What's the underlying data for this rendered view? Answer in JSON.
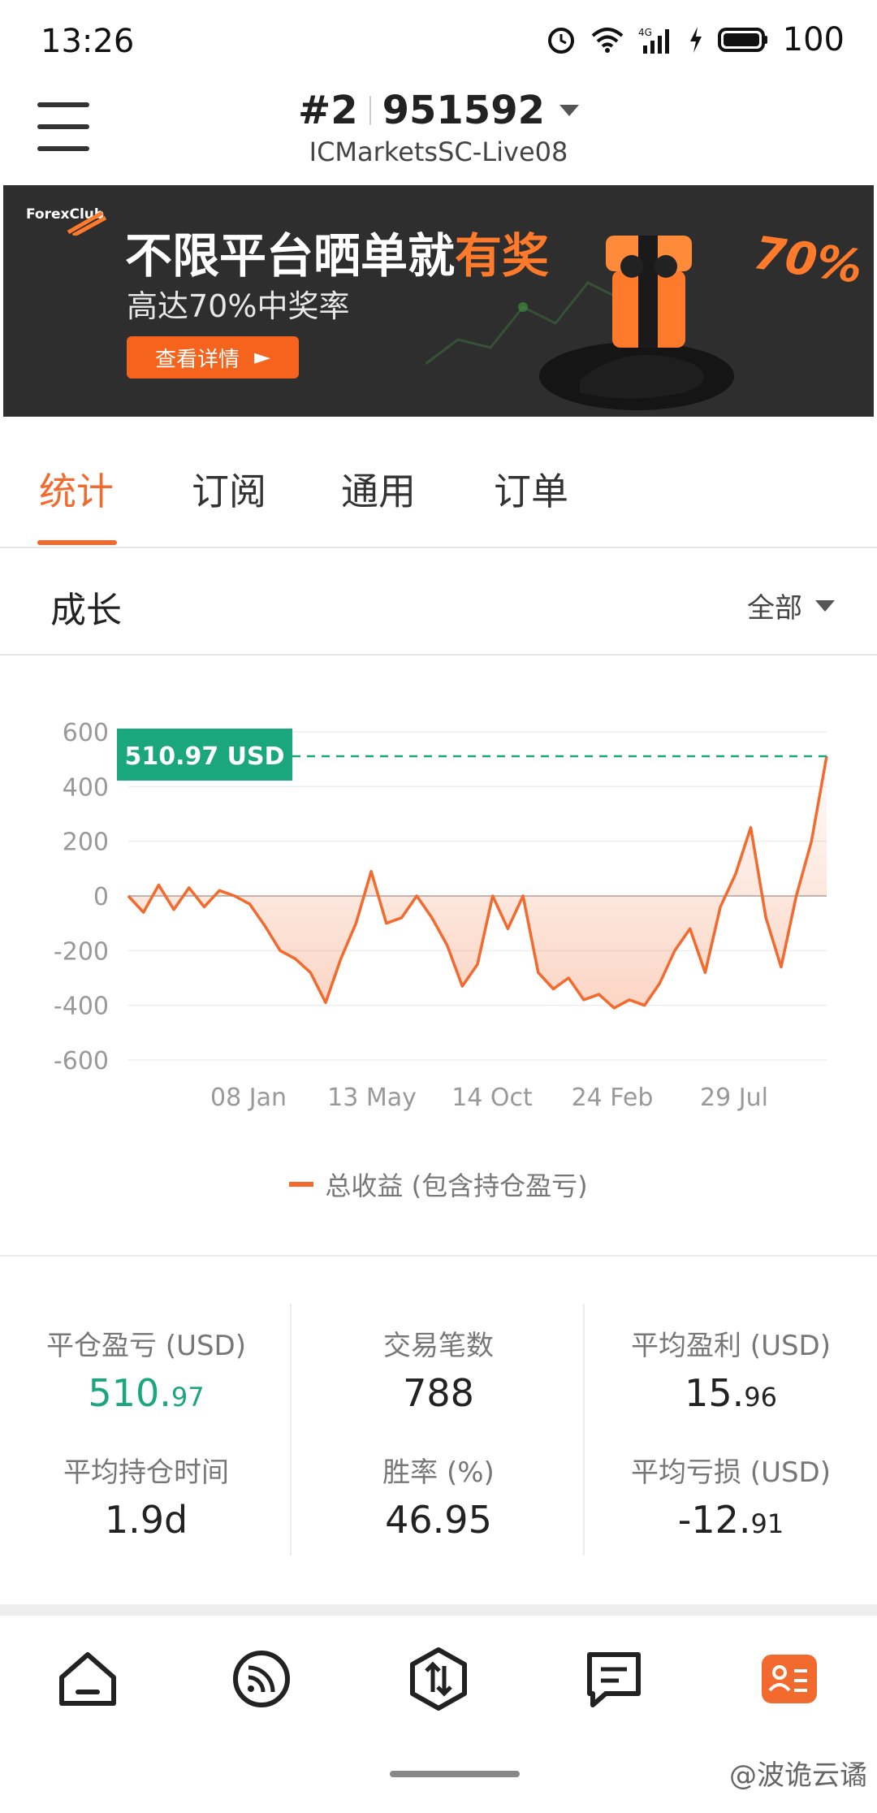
{
  "status": {
    "time": "13:26",
    "battery": "100",
    "network": "4G"
  },
  "header": {
    "account_num": "#2",
    "account_id": "951592",
    "server": "ICMarketsSC-Live08"
  },
  "banner": {
    "brand": "ForexClub",
    "headline_main": "不限平台晒单就",
    "headline_accent": "有奖",
    "subline": "高达70%中奖率",
    "cta": "查看详情",
    "percent": "70%"
  },
  "tabs": [
    {
      "label": "统计",
      "active": true
    },
    {
      "label": "订阅",
      "active": false
    },
    {
      "label": "通用",
      "active": false
    },
    {
      "label": "订单",
      "active": false
    }
  ],
  "section": {
    "title": "成长",
    "filter": "全部"
  },
  "chart_data": {
    "type": "line",
    "yticks": [
      "600",
      "400",
      "200",
      "0",
      "-200",
      "-400",
      "-600"
    ],
    "xticks": [
      "08 Jan",
      "13 May",
      "14 Oct",
      "24 Feb",
      "29 Jul"
    ],
    "ylim": [
      -600,
      600
    ],
    "marker_label": "510.97 USD",
    "marker_value": 510.97,
    "legend": "总收益 (包含持仓盈亏)",
    "colors": {
      "line": "#f26a2e",
      "marker": "#1aa77e"
    },
    "series": [
      {
        "values": [
          0,
          -60,
          40,
          -50,
          30,
          -40,
          20,
          0,
          -30,
          -110,
          -200,
          -230,
          -280,
          -390,
          -230,
          -100,
          90,
          -100,
          -80,
          0,
          -80,
          -180,
          -330,
          -250,
          0,
          -120,
          0,
          -280,
          -340,
          -300,
          -380,
          -360,
          -410,
          -380,
          -400,
          -320,
          -200,
          -120,
          -280,
          -40,
          80,
          250,
          -80,
          -260,
          0,
          200,
          510.97
        ]
      }
    ]
  },
  "stats": [
    {
      "label": "平仓盈亏 (USD)",
      "int": "510.",
      "dec": "97",
      "green": true
    },
    {
      "label": "交易笔数",
      "int": "788",
      "dec": "",
      "green": false
    },
    {
      "label": "平均盈利 (USD)",
      "int": "15.",
      "dec": "96",
      "green": false
    },
    {
      "label": "平均持仓时间",
      "int": "1.9d",
      "dec": "",
      "green": false
    },
    {
      "label": "胜率 (%)",
      "int": "46.95",
      "dec": "",
      "green": false
    },
    {
      "label": "平均亏损 (USD)",
      "int": "-12.",
      "dec": "91",
      "green": false
    }
  ],
  "nav": [
    {
      "icon": "home-icon",
      "active": false
    },
    {
      "icon": "feed-icon",
      "active": false
    },
    {
      "icon": "trade-icon",
      "active": false
    },
    {
      "icon": "message-icon",
      "active": false
    },
    {
      "icon": "profile-card-icon",
      "active": true
    }
  ],
  "watermark": "@波诡云谲"
}
